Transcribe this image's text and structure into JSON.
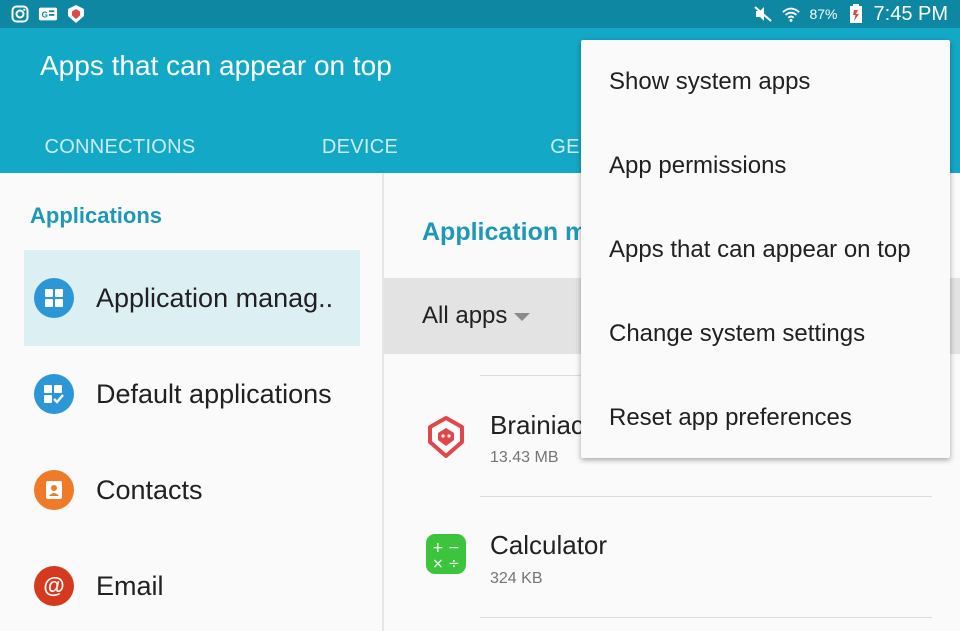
{
  "status_bar": {
    "time": "7:45 PM",
    "battery": "87%",
    "icons": [
      "instagram-icon",
      "g-news-icon",
      "brainiac-shield-icon",
      "mute-icon",
      "wifi-icon",
      "battery-icon"
    ]
  },
  "header": {
    "title": "Apps that can appear on top",
    "tabs": [
      {
        "label": "CONNECTIONS"
      },
      {
        "label": "DEVICE"
      },
      {
        "label": "GE"
      }
    ]
  },
  "sidebar": {
    "section_title": "Applications",
    "items": [
      {
        "label": "Application manag..",
        "icon": "grid-icon",
        "color": "#2b97d6",
        "selected": true
      },
      {
        "label": "Default applications",
        "icon": "default-apps-icon",
        "color": "#2b97d6",
        "selected": false
      },
      {
        "label": "Contacts",
        "icon": "contacts-icon",
        "color": "#ef7a2a",
        "selected": false
      },
      {
        "label": "Email",
        "icon": "at-icon",
        "color": "#d63a1e",
        "selected": false
      }
    ]
  },
  "main": {
    "title": "Application m",
    "filter_label": "All apps",
    "apps": [
      {
        "name": "Brainiac",
        "size": "13.43 MB",
        "icon": "brainiac-icon"
      },
      {
        "name": "Calculator",
        "size": "324 KB",
        "icon": "calculator-icon"
      }
    ]
  },
  "menu": {
    "items": [
      {
        "label": "Show system apps"
      },
      {
        "label": "App permissions"
      },
      {
        "label": "Apps that can appear on top"
      },
      {
        "label": "Change system settings"
      },
      {
        "label": "Reset app preferences"
      }
    ]
  },
  "colors": {
    "status_bar": "#0e87a3",
    "header": "#14a8c7",
    "accent_text": "#1e98b6",
    "selected_bg": "#dceff3"
  }
}
